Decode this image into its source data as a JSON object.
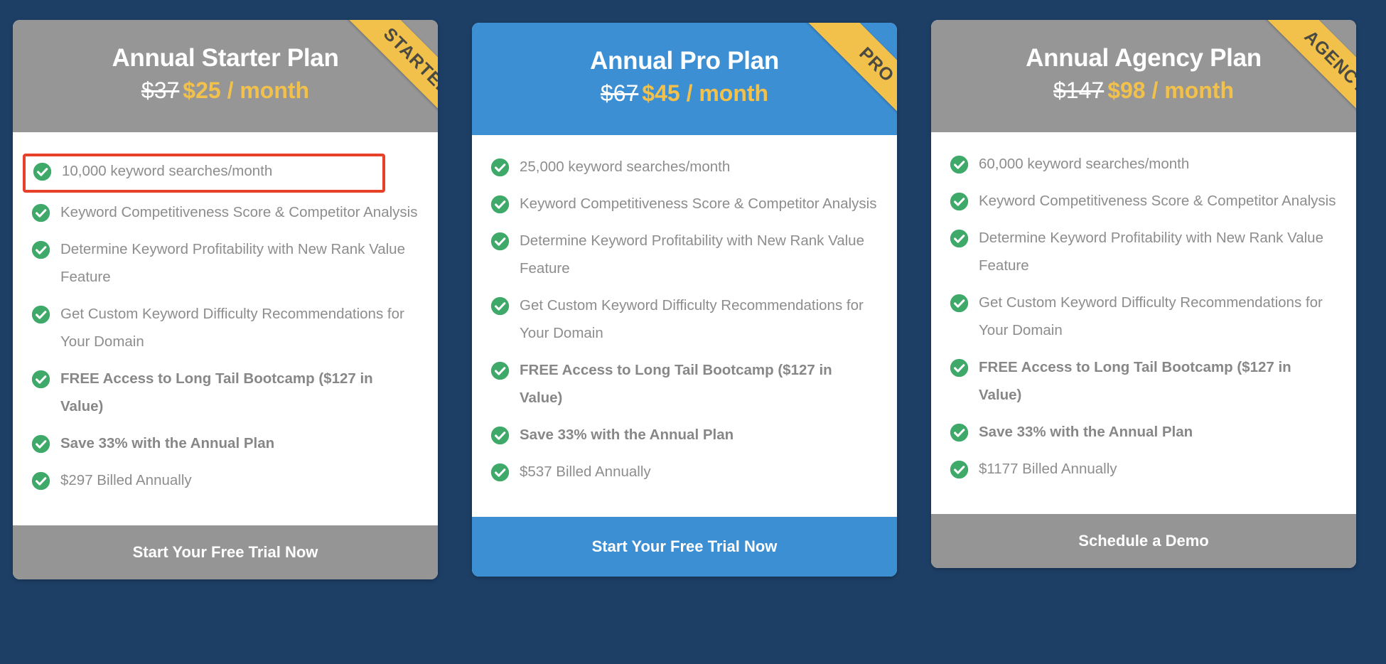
{
  "page": {
    "background_color": "#1d3f66",
    "accent_gold": "#f2c14b",
    "accent_blue": "#3d8fd4",
    "accent_gray": "#969696",
    "check_color": "#3fa96a",
    "highlight_color": "#e8412a"
  },
  "plans": [
    {
      "title": "Annual Starter Plan",
      "ribbon": "STARTER",
      "price_old": "$37",
      "price_new": "$25 / month",
      "header_style": "gray",
      "cta_label": "Start Your Free Trial Now",
      "cta_style": "gray",
      "highlighted_feature_index": 0,
      "features": [
        {
          "text": "10,000 keyword searches/month",
          "bold": false
        },
        {
          "text": "Keyword Competitiveness Score & Competitor Analysis",
          "bold": false
        },
        {
          "text": "Determine Keyword Profitability with New Rank Value Feature",
          "bold": false
        },
        {
          "text": "Get Custom Keyword Difficulty Recommendations for Your Domain",
          "bold": false
        },
        {
          "text": "FREE Access to Long Tail Bootcamp ($127 in Value)",
          "bold": true
        },
        {
          "text": "Save 33% with the Annual Plan",
          "bold": true
        },
        {
          "text": "$297 Billed Annually",
          "bold": false
        }
      ]
    },
    {
      "title": "Annual Pro Plan",
      "ribbon": "PRO",
      "price_old": "$67",
      "price_new": "$45 / month",
      "header_style": "blue",
      "cta_label": "Start Your Free Trial Now",
      "cta_style": "blue",
      "highlighted_feature_index": -1,
      "features": [
        {
          "text": "25,000 keyword searches/month",
          "bold": false
        },
        {
          "text": "Keyword Competitiveness Score & Competitor Analysis",
          "bold": false
        },
        {
          "text": "Determine Keyword Profitability with New Rank Value Feature",
          "bold": false
        },
        {
          "text": "Get Custom Keyword Difficulty Recommendations for Your Domain",
          "bold": false
        },
        {
          "text": "FREE Access to Long Tail Bootcamp ($127 in Value)",
          "bold": true
        },
        {
          "text": "Save 33% with the Annual Plan",
          "bold": true
        },
        {
          "text": "$537 Billed Annually",
          "bold": false
        }
      ]
    },
    {
      "title": "Annual Agency Plan",
      "ribbon": "AGENCY",
      "price_old": "$147",
      "price_new": "$98 / month",
      "header_style": "gray",
      "cta_label": "Schedule a Demo",
      "cta_style": "gray",
      "highlighted_feature_index": -1,
      "features": [
        {
          "text": "60,000 keyword searches/month",
          "bold": false
        },
        {
          "text": "Keyword Competitiveness Score & Competitor Analysis",
          "bold": false
        },
        {
          "text": "Determine Keyword Profitability with New Rank Value Feature",
          "bold": false
        },
        {
          "text": "Get Custom Keyword Difficulty Recommendations for Your Domain",
          "bold": false
        },
        {
          "text": "FREE Access to Long Tail Bootcamp ($127 in Value)",
          "bold": true
        },
        {
          "text": "Save 33% with the Annual Plan",
          "bold": true
        },
        {
          "text": "$1177 Billed Annually",
          "bold": false
        }
      ]
    }
  ]
}
